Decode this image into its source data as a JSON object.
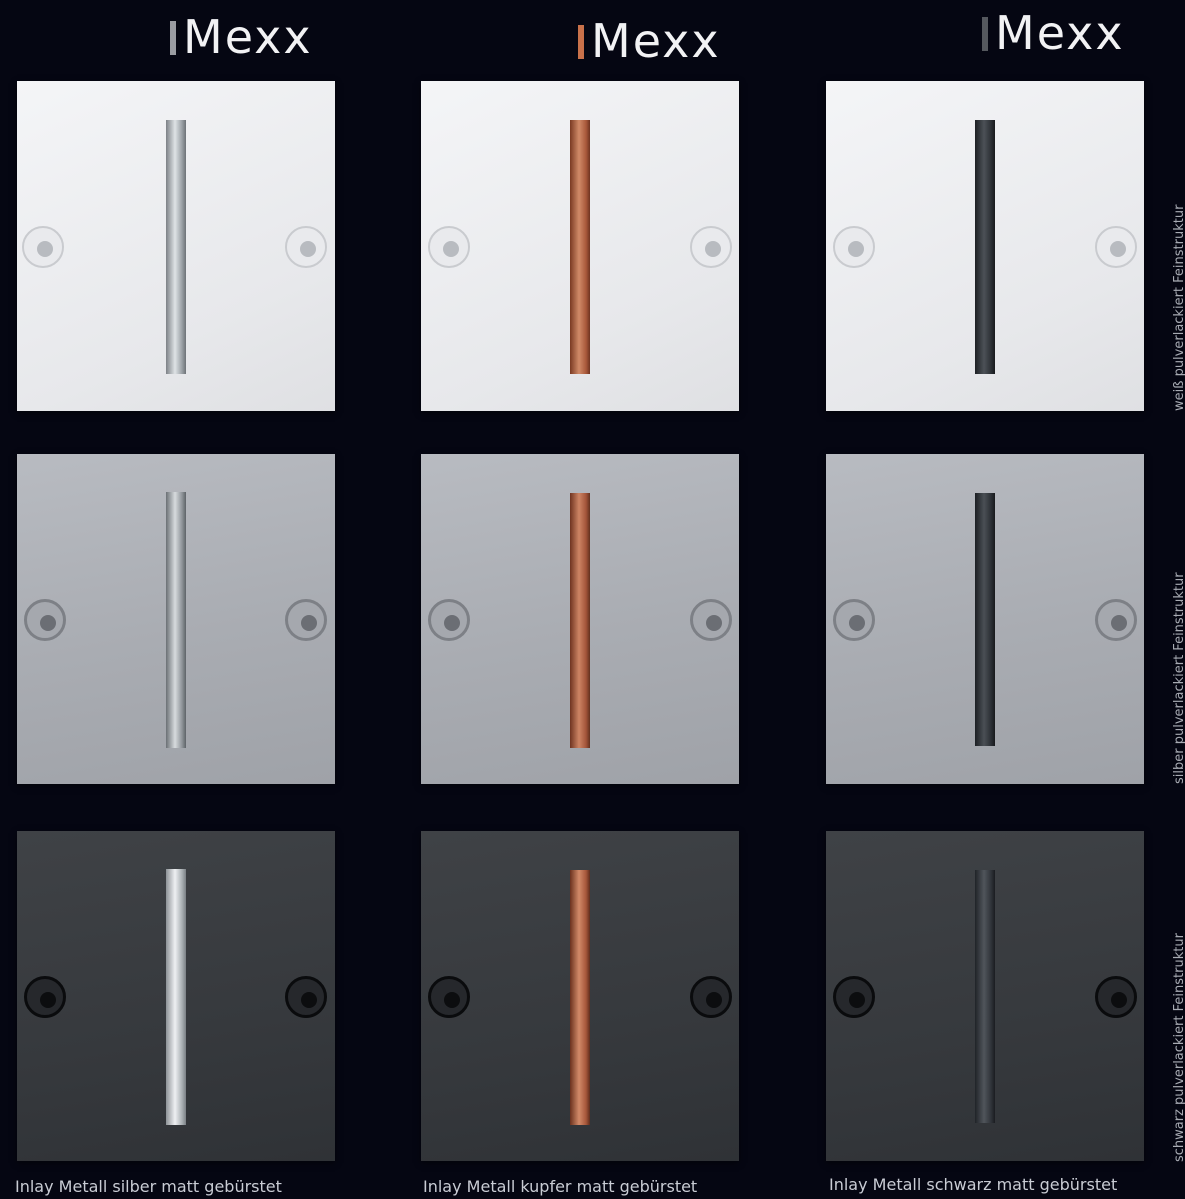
{
  "brand": {
    "name": "Mexx",
    "bar_colors": [
      "#9a9ca2",
      "#c9714a",
      "#55585e"
    ]
  },
  "columns": [
    {
      "caption": "Inlay Metall silber matt gebürstet",
      "inlay_color": "silver"
    },
    {
      "caption": "Inlay Metall kupfer matt gebürstet",
      "inlay_color": "copper"
    },
    {
      "caption": "Inlay Metall schwarz matt gebürstet",
      "inlay_color": "black"
    }
  ],
  "rows": [
    {
      "label": "weiß pulverlackiert Feinstruktur",
      "finish": "white"
    },
    {
      "label": "silber pulverlackiert Feinstruktur",
      "finish": "silver"
    },
    {
      "label": "schwarz pulverlackiert Feinstruktur",
      "finish": "black"
    }
  ],
  "colors": {
    "background": "#050612",
    "inlay_silver": "#c8ccd0",
    "inlay_copper": "#b9684a",
    "inlay_black": "#33373c"
  }
}
